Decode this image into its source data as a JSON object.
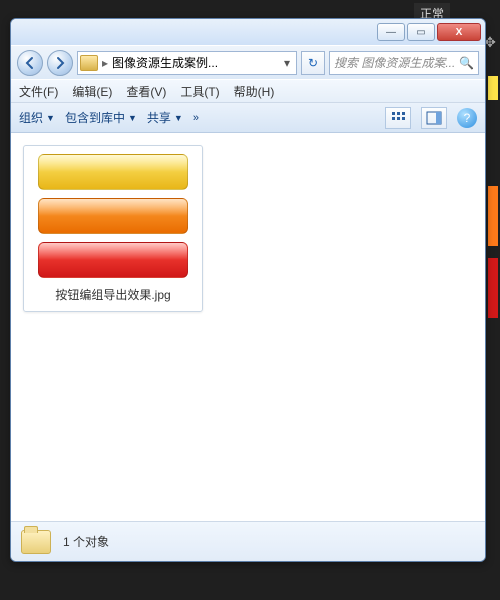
{
  "backdrop": {
    "label": "正常"
  },
  "titlebar": {
    "min": "—",
    "max": "▭",
    "close": "X"
  },
  "nav": {
    "path_label": "图像资源生成案例...",
    "refresh": "↻",
    "search_placeholder": "搜索 图像资源生成案..."
  },
  "menubar": {
    "file": "文件(F)",
    "edit": "编辑(E)",
    "view": "查看(V)",
    "tools": "工具(T)",
    "help": "帮助(H)"
  },
  "cmdbar": {
    "organize": "组织",
    "include": "包含到库中",
    "share": "共享",
    "more": "»",
    "help": "?"
  },
  "item": {
    "filename": "按钮编组导出效果.jpg"
  },
  "status": {
    "count_text": "1 个对象"
  }
}
